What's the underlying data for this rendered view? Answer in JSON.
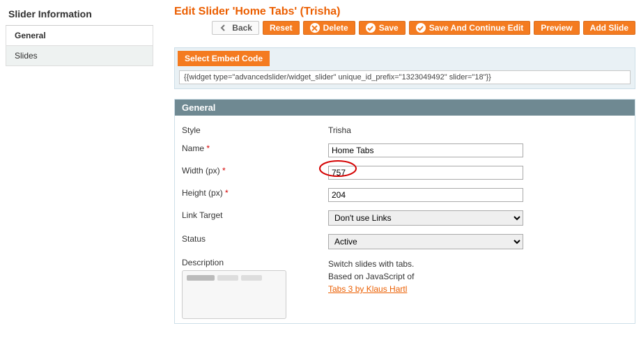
{
  "sidebar": {
    "title": "Slider Information",
    "tabs": [
      {
        "label": "General",
        "active": true
      },
      {
        "label": "Slides",
        "active": false
      }
    ]
  },
  "page": {
    "title": "Edit Slider 'Home Tabs' (Trisha)"
  },
  "buttons": {
    "back": "Back",
    "reset": "Reset",
    "delete": "Delete",
    "save": "Save",
    "save_continue": "Save And Continue Edit",
    "preview": "Preview",
    "add_slide": "Add Slide"
  },
  "embed": {
    "header": "Select Embed Code",
    "value": "{{widget type=\"advancedslider/widget_slider\" unique_id_prefix=\"1323049492\" slider=\"18\"}}"
  },
  "section": {
    "title": "General"
  },
  "form": {
    "style_label": "Style",
    "style_value": "Trisha",
    "name_label": "Name",
    "name_value": "Home Tabs",
    "width_label": "Width (px)",
    "width_value": "757",
    "height_label": "Height (px)",
    "height_value": "204",
    "link_target_label": "Link Target",
    "link_target_value": "Don't use Links",
    "status_label": "Status",
    "status_value": "Active",
    "description_label": "Description",
    "description_text_1": "Switch slides with tabs.",
    "description_text_2": "Based on JavaScript of ",
    "description_link": "Tabs 3 by Klaus Hartl"
  }
}
